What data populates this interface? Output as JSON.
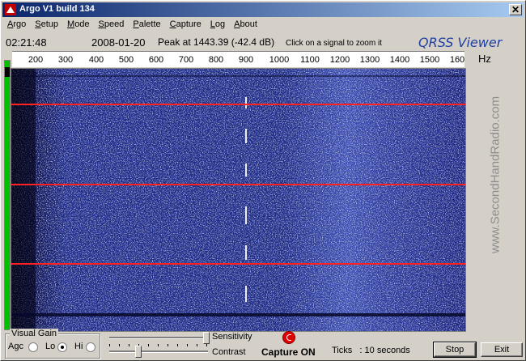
{
  "window": {
    "title": "Argo V1 build 134",
    "close_glyph": "✕"
  },
  "menu": [
    "Argo",
    "Setup",
    "Mode",
    "Speed",
    "Palette",
    "Capture",
    "Log",
    "About"
  ],
  "status": {
    "time": "02:21:48",
    "date": "2008-01-20",
    "peak": "Peak at 1443.39 (-42.4 dB)",
    "hint": "Click on a signal to zoom it",
    "brand": "QRSS Viewer"
  },
  "scale": {
    "ticks": [
      "200",
      "300",
      "400",
      "500",
      "600",
      "700",
      "800",
      "900",
      "1000",
      "1100",
      "1200",
      "1300",
      "1400",
      "1500",
      "160"
    ],
    "unit": "Hz"
  },
  "watermark": "www.SecondHandRadio.com",
  "controls": {
    "visual_gain_label": "Visual Gain",
    "agc_label": "Agc",
    "lo_label": "Lo",
    "hi_label": "Hi",
    "gain_selected": "Lo",
    "sensitivity_label": "Sensitivity",
    "sensitivity_level": 0.98,
    "contrast_label": "Contrast",
    "contrast_level": 0.32,
    "capture_status": "Capture ON",
    "ticks_text": "Ticks   : 10 seconds",
    "stop_label": "Stop",
    "exit_label": "Exit"
  },
  "colors": {
    "titlebar_start": "#0a246a",
    "spectrum_bg": "#1a237a",
    "marker_line": "#ff2020",
    "record": "#e00000",
    "level_green": "#00c000"
  }
}
